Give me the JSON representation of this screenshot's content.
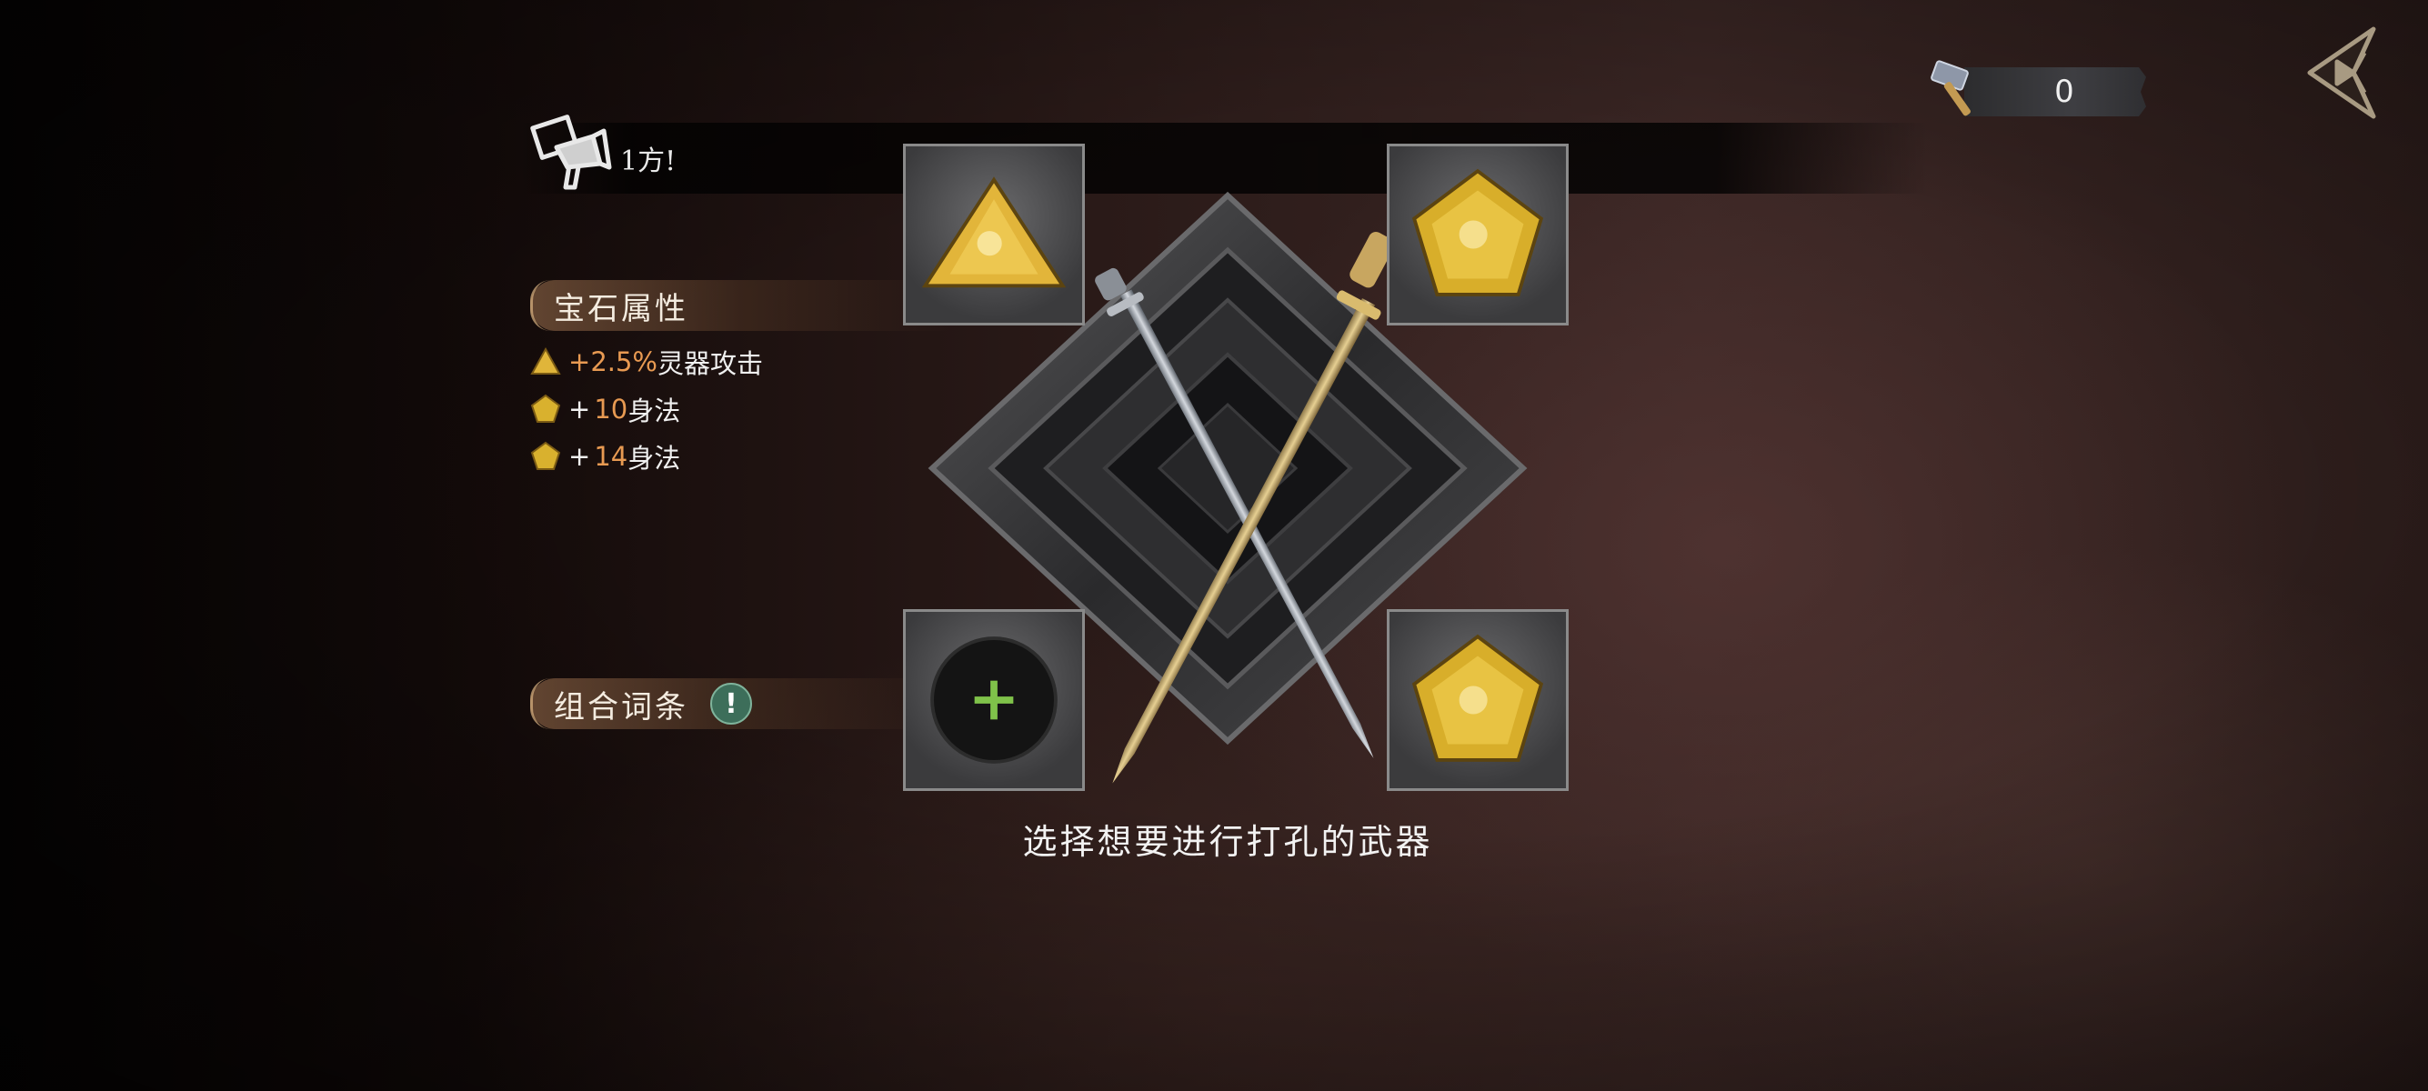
{
  "broadcast": {
    "text": "1方!",
    "icon": "megaphone-icon"
  },
  "resource": {
    "icon": "hammer-icon",
    "value": "0"
  },
  "back_button": {
    "icon": "back-arrow-icon"
  },
  "gem_attributes": {
    "title": "宝石属性",
    "items": [
      {
        "icon": "triangle-gem-icon",
        "prefix": "+",
        "value": "2.5%",
        "name": "灵器攻击"
      },
      {
        "icon": "pentagon-gem-icon",
        "prefix": "+ ",
        "value": "10",
        "name": "身法"
      },
      {
        "icon": "pentagon-gem-icon",
        "prefix": "+ ",
        "value": "14",
        "name": "身法"
      }
    ]
  },
  "combo_entries": {
    "title": "组合词条",
    "badge": "!"
  },
  "slots": [
    {
      "id": "top-left",
      "gem": "triangle-gem-icon"
    },
    {
      "id": "top-right",
      "gem": "pentagon-gem-icon"
    },
    {
      "id": "bottom-left",
      "gem": "add-icon"
    },
    {
      "id": "bottom-right",
      "gem": "pentagon-gem-icon"
    }
  ],
  "hint": "选择想要进行打孔的武器",
  "colors": {
    "accent_orange": "#e89a52",
    "gem_gold": "#e8c33a",
    "add_green": "#7fc24a"
  }
}
